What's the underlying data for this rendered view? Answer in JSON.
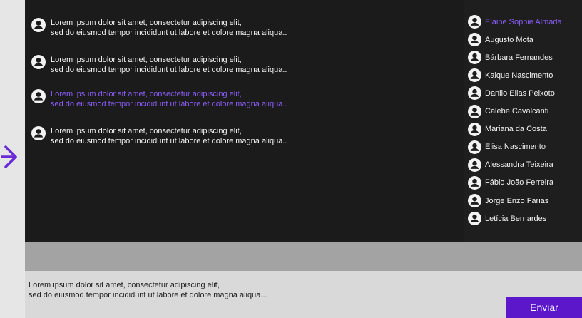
{
  "colors": {
    "accent": "#5b17c9",
    "highlight_text": "#8a5cf6",
    "chat_background": "#1b1b1b",
    "compose_background": "#d9d9d9"
  },
  "nav": {
    "icon": "arrow-right-icon"
  },
  "messages": [
    {
      "line1": "Lorem ipsum dolor sit amet, consectetur adipiscing elit,",
      "line2": "sed do eiusmod tempor incididunt ut labore et dolore magna aliqua..",
      "highlighted": false
    },
    {
      "line1": "Lorem ipsum dolor sit amet, consectetur adipiscing elit,",
      "line2": "sed do eiusmod tempor incididunt ut labore et dolore magna aliqua..",
      "highlighted": false
    },
    {
      "line1": "Lorem ipsum dolor sit amet, consectetur adipiscing elit,",
      "line2": "sed do eiusmod tempor incididunt ut labore et dolore magna aliqua..",
      "highlighted": true
    },
    {
      "line1": "Lorem ipsum dolor sit amet, consectetur adipiscing elit,",
      "line2": "sed do eiusmod tempor incididunt ut labore et dolore magna aliqua..",
      "highlighted": false
    }
  ],
  "users": [
    {
      "name": "Elaine Sophie Almada",
      "active": true
    },
    {
      "name": "Augusto Mota",
      "active": false
    },
    {
      "name": "Bárbara Fernandes",
      "active": false
    },
    {
      "name": "Kaique Nascimento",
      "active": false
    },
    {
      "name": "Danilo Elias Peixoto",
      "active": false
    },
    {
      "name": "Calebe Cavalcanti",
      "active": false
    },
    {
      "name": "Mariana da Costa",
      "active": false
    },
    {
      "name": "Elisa Nascimento",
      "active": false
    },
    {
      "name": "Alessandra Teixeira",
      "active": false
    },
    {
      "name": "Fábio João Ferreira",
      "active": false
    },
    {
      "name": "Jorge Enzo Farias",
      "active": false
    },
    {
      "name": "Letícia  Bernardes",
      "active": false
    }
  ],
  "compose": {
    "line1": "Lorem ipsum dolor sit amet, consectetur adipiscing elit,",
    "line2": "sed do eiusmod tempor incididunt ut labore et dolore magna aliqua..."
  },
  "send_button": {
    "label": "Enviar"
  }
}
